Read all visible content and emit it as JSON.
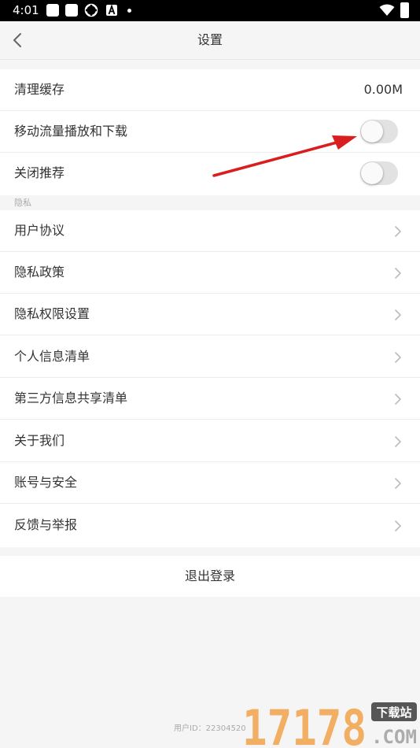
{
  "status_bar": {
    "time": "4:01"
  },
  "header": {
    "title": "设置"
  },
  "cache": {
    "label": "清理缓存",
    "value": "0.00M"
  },
  "toggles": [
    {
      "label": "移动流量播放和下载",
      "on": false
    },
    {
      "label": "关闭推荐",
      "on": false
    }
  ],
  "privacy_section": {
    "label": "隐私"
  },
  "menu_items": [
    {
      "label": "用户协议"
    },
    {
      "label": "隐私政策"
    },
    {
      "label": "隐私权限设置"
    },
    {
      "label": "个人信息清单"
    },
    {
      "label": "第三方信息共享清单"
    },
    {
      "label": "关于我们"
    },
    {
      "label": "账号与安全"
    },
    {
      "label": "反馈与举报"
    }
  ],
  "logout": {
    "label": "退出登录"
  },
  "user_id": {
    "label": "用户ID：",
    "value": "22304520"
  },
  "watermark": {
    "number": "17178",
    "tag": "下载站",
    "domain": ".COM"
  },
  "colors": {
    "annotation_arrow": "#d81e1e",
    "toggle_off_track": "#e2e2e2",
    "watermark_orange": "#f2a34a"
  }
}
